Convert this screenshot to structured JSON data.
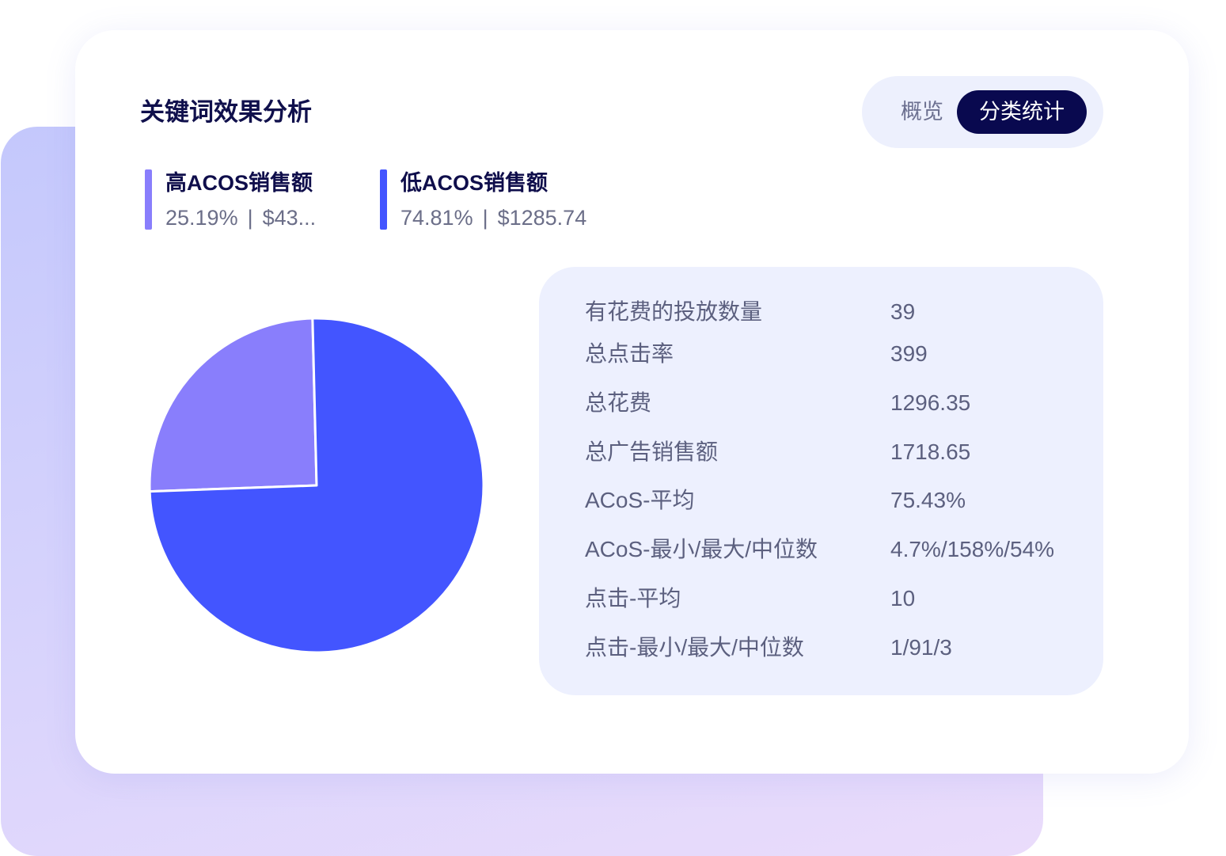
{
  "title": "关键词效果分析",
  "view_toggle": {
    "options": [
      {
        "label": "概览"
      },
      {
        "label": "分类统计"
      }
    ],
    "active_index": 1
  },
  "legend_separator": "|",
  "chart_data": {
    "type": "pie",
    "legend_position": "top-left",
    "slices": [
      {
        "name": "高ACOS销售额",
        "value": 25.19,
        "percent_label": "25.19%",
        "amount_label": "$43...",
        "color": "#897efc"
      },
      {
        "name": "低ACOS销售额",
        "value": 74.81,
        "percent_label": "74.81%",
        "amount_label": "$1285.74",
        "color": "#4355ff"
      }
    ]
  },
  "stats": [
    {
      "label": "有花费的投放数量",
      "value": "39"
    },
    {
      "label": "总点击率",
      "value": "399"
    },
    {
      "label": "总花费",
      "value": "1296.35"
    },
    {
      "label": "总广告销售额",
      "value": "1718.65"
    },
    {
      "label": "ACoS-平均",
      "value": "75.43%"
    },
    {
      "label": "ACoS-最小/最大/中位数",
      "value": "4.7%/158%/54%"
    },
    {
      "label": "点击-平均",
      "value": "10"
    },
    {
      "label": "点击-最小/最大/中位数",
      "value": "1/91/3"
    }
  ],
  "colors": {
    "title": "#10104c",
    "toggle_bg": "#edf0fd",
    "toggle_active": "#09094f",
    "panel_bg": "#edf0fe",
    "text_muted": "#5c607f"
  }
}
